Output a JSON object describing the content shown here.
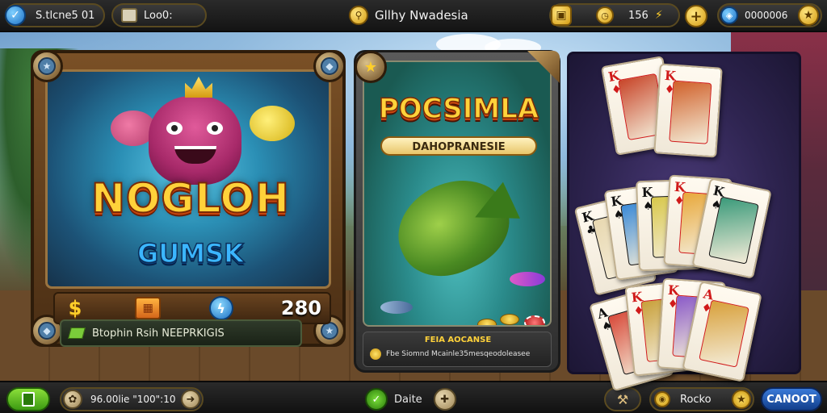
{
  "topbar": {
    "left_pill_label": "S.tlcne5 01",
    "middle_pill_label": "Loo0:",
    "title": "Gllhy Nwadesia",
    "currency_value": "156",
    "plus_symbol": "+",
    "score_value": "0000006",
    "icons": [
      "check-icon",
      "window-icon",
      "magnifier-icon",
      "wallet-icon",
      "clock-icon",
      "bolt-icon",
      "plus-icon",
      "globe-icon",
      "star-icon"
    ]
  },
  "panel_left": {
    "title": "NOGLOH",
    "subtitle": "GUMSK",
    "stat_value": "280",
    "footer_text": "Btophin Rsih NEEPRKIGIS",
    "icons": [
      "crown-icon",
      "monster-icon",
      "fish-icon",
      "dollar-icon",
      "gift-icon",
      "lightning-icon"
    ]
  },
  "panel_middle": {
    "title": "POCSIMLA",
    "subtitle": "DAHOPRANESIE",
    "info_title": "FEIA AOCANSE",
    "info_line": "Fbe Siomnd Mcainle35mesqeodoleasee",
    "icons": [
      "star-badge-icon",
      "fish-icon",
      "coin-icon",
      "chip-icon"
    ]
  },
  "panel_right": {
    "cards": [
      {
        "rank": "K",
        "suit": "♦",
        "color": "#d01a1a"
      },
      {
        "rank": "K",
        "suit": "♦",
        "color": "#d01a1a"
      },
      {
        "rank": "K",
        "suit": "♣",
        "color": "#111111"
      },
      {
        "rank": "K",
        "suit": "♠",
        "color": "#111111"
      },
      {
        "rank": "K",
        "suit": "♠",
        "color": "#111111"
      },
      {
        "rank": "K",
        "suit": "♦",
        "color": "#d01a1a"
      },
      {
        "rank": "K",
        "suit": "♠",
        "color": "#111111"
      },
      {
        "rank": "A",
        "suit": "♠",
        "color": "#111111"
      },
      {
        "rank": "K",
        "suit": "♦",
        "color": "#d01a1a"
      },
      {
        "rank": "K",
        "suit": "♦",
        "color": "#d01a1a"
      },
      {
        "rank": "A",
        "suit": "♦",
        "color": "#d01a1a"
      }
    ]
  },
  "bottombar": {
    "timer_text": "96.00lie \"100\":10",
    "center_label": "Daite",
    "right_label": "Rocko",
    "cancel_label": "CANOOT",
    "icons": [
      "copy-icon",
      "gear-icon",
      "arrow-icon",
      "checkmark-icon",
      "plus-circle-icon",
      "hammer-icon",
      "coin-icon",
      "star-icon"
    ]
  },
  "colors": {
    "gold": "#ffd23a",
    "title_stroke": "#7a2a06",
    "subtitle_blue": "#3bb6ff",
    "green_button": "#3c9a12",
    "blue_button": "#123e8a",
    "panel_wood": "#7a5026",
    "panel_purple": "#2e2450"
  }
}
